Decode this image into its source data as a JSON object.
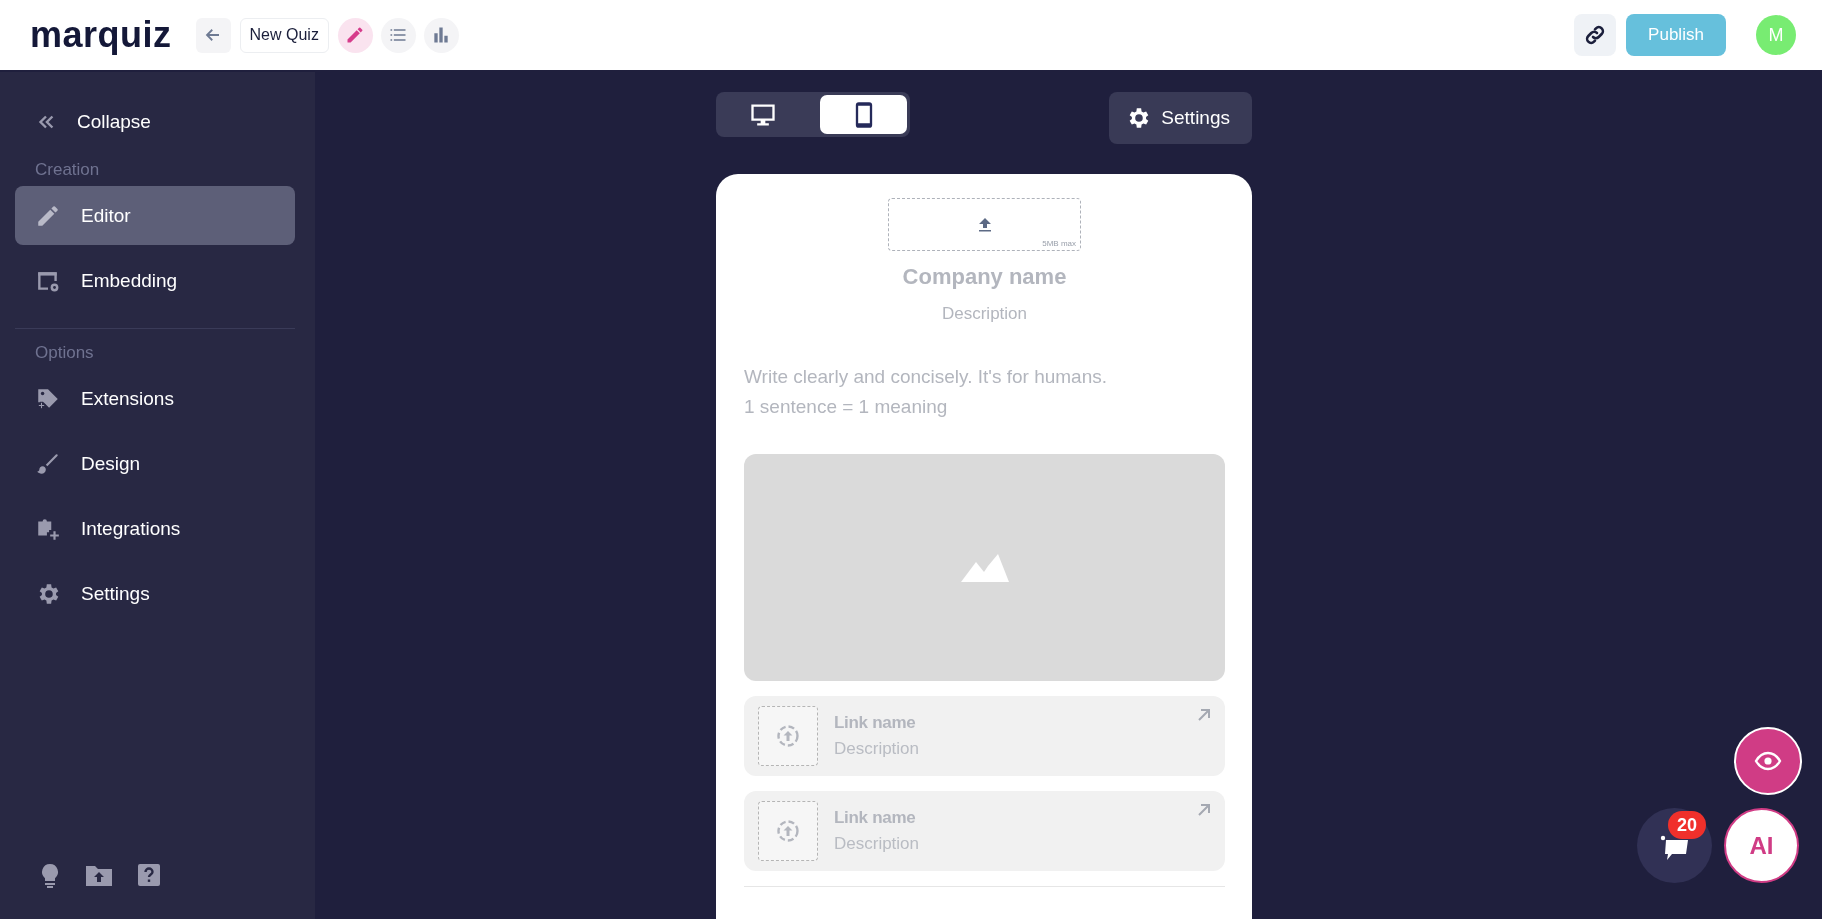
{
  "header": {
    "logo": "marquiz",
    "quiz_name": "New Quiz",
    "modes": [
      {
        "kind": "edit",
        "selected": true
      },
      {
        "kind": "list",
        "selected": false
      },
      {
        "kind": "stats",
        "selected": false
      }
    ],
    "publish": "Publish",
    "avatar": "M"
  },
  "sidebar": {
    "collapse": "Collapse",
    "sections": [
      {
        "title": "Creation",
        "items": [
          {
            "kind": "editor",
            "label": "Editor",
            "selected": true
          },
          {
            "kind": "embedding",
            "label": "Embedding",
            "selected": false
          }
        ]
      },
      {
        "title": "Options",
        "items": [
          {
            "kind": "extensions",
            "label": "Extensions",
            "selected": false
          },
          {
            "kind": "design",
            "label": "Design",
            "selected": false
          },
          {
            "kind": "integrations",
            "label": "Integrations",
            "selected": false
          },
          {
            "kind": "settings",
            "label": "Settings",
            "selected": false
          }
        ]
      }
    ]
  },
  "preview": {
    "devices": [
      {
        "kind": "desktop",
        "selected": false
      },
      {
        "kind": "mobile",
        "selected": true
      }
    ],
    "settings": "Settings",
    "upload_hint": "5MB max",
    "company_name": "Company name",
    "description": "Description",
    "body_lines": [
      "Write clearly and concisely. It's for humans.",
      "1 sentence = 1 meaning"
    ],
    "links": [
      {
        "name": "Link name",
        "description": "Description"
      },
      {
        "name": "Link name",
        "description": "Description"
      }
    ]
  },
  "chat_badge": "20",
  "ai_button": "AI"
}
